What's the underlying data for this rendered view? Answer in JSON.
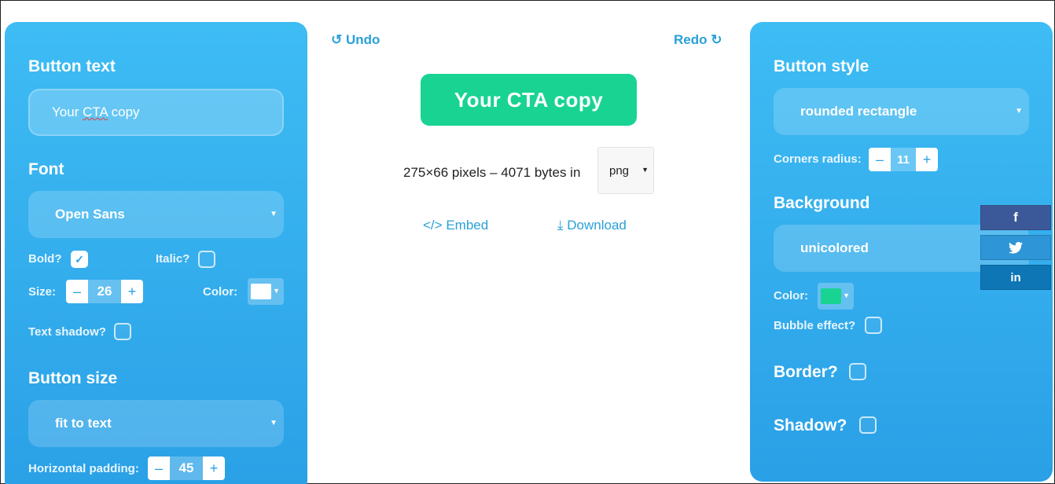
{
  "left_panel": {
    "button_text_heading": "Button text",
    "button_text_value": "Your CTA copy",
    "font_heading": "Font",
    "font_value": "Open Sans",
    "bold_label": "Bold?",
    "italic_label": "Italic?",
    "size_label": "Size:",
    "size_value": "26",
    "color_label": "Color:",
    "text_color": "#ffffff",
    "text_shadow_label": "Text shadow?",
    "button_size_heading": "Button size",
    "button_size_value": "fit to text",
    "h_padding_label": "Horizontal padding:",
    "h_padding_value": "45",
    "bold_checked": true,
    "italic_checked": false,
    "text_shadow_checked": false
  },
  "center": {
    "undo_label": "Undo",
    "redo_label": "Redo",
    "preview_text": "Your CTA copy",
    "preview_color": "#19d393",
    "info_text": "275×66 pixels – 4071 bytes in",
    "format_value": "png",
    "embed_label": "Embed",
    "download_label": "Download"
  },
  "right_panel": {
    "button_style_heading": "Button style",
    "button_style_value": "rounded rectangle",
    "corners_radius_label": "Corners radius:",
    "corners_radius_value": "11",
    "background_heading": "Background",
    "background_value": "unicolored",
    "bg_color_label": "Color:",
    "bg_color": "#19d393",
    "bubble_label": "Bubble effect?",
    "border_label": "Border?",
    "shadow_label": "Shadow?",
    "bubble_checked": false,
    "border_checked": false,
    "shadow_checked": false
  },
  "social": {
    "facebook": "f",
    "facebook_color": "#3b5998",
    "twitter_color": "#2e95d6",
    "linkedin": "in",
    "linkedin_color": "#0e76b4"
  },
  "icons": [
    "undo-icon",
    "redo-icon",
    "code-icon",
    "download-icon",
    "check-icon",
    "twitter-bird-icon"
  ]
}
